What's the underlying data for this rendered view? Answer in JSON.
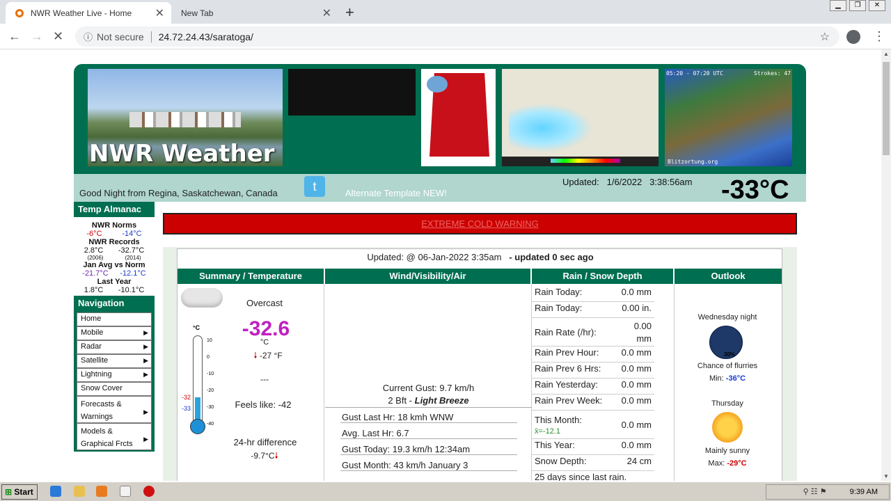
{
  "browser": {
    "tabs": [
      {
        "label": "NWR Weather Live - Home",
        "close": "✕"
      },
      {
        "label": "New Tab",
        "close": "✕"
      }
    ],
    "new_tab": "+",
    "security": "Not secure",
    "url": "24.72.24.43/saratoga/"
  },
  "header": {
    "site_title": "NWR Weather",
    "lightning_time": "05:20 - 07:20 UTC",
    "lightning_strokes": "Strokes: 47",
    "lightning_credit": "Blitzortung.org",
    "greeting": "Good Night from Regina, Saskatchewan, Canada",
    "alt_template": "Alternate Template NEW!",
    "updated_label": "Updated:",
    "updated_date": "1/6/2022",
    "updated_time": "3:38:56am",
    "current_temp": "-33°C"
  },
  "almanac": {
    "heading": "Temp Almanac",
    "norms_label": "NWR Norms",
    "norm_high": "-6°C",
    "norm_low": "-14°C",
    "records_label": "NWR Records",
    "record_high": "2.8°C",
    "record_low": "-32.7°C",
    "record_high_year": "(2006)",
    "record_low_year": "(2014)",
    "avg_label": "Jan Avg vs Norm",
    "avg_high": "-21.7°C",
    "avg_low": "-12.1°C",
    "last_year_label": "Last Year",
    "last_year_high": "1.8°C",
    "last_year_low": "-10.1°C"
  },
  "navigation": {
    "heading": "Navigation",
    "items": [
      "Home",
      "Mobile",
      "Radar",
      "Satellite",
      "Lightning",
      "Snow Cover",
      "Forecasts & Warnings",
      "Models & Graphical Frcts"
    ]
  },
  "warning": "EXTREME COLD WARNING",
  "panel": {
    "updated": "Updated: @ 06-Jan-2022 3:35am",
    "updated_ago": "- updated 0 sec ago",
    "headers": [
      "Summary / Temperature",
      "Wind/Visibility/Air",
      "Rain / Snow Depth",
      "Outlook"
    ]
  },
  "summary": {
    "condition": "Overcast",
    "temp": "-32.6",
    "unit": "°C",
    "temp_f": "-27 °F",
    "dashes": "---",
    "feels_like": "Feels like: -42",
    "diff_label": "24-hr difference",
    "diff_value": "-9.7°C",
    "scale_unit": "°C",
    "scale_ticks": [
      "10",
      "0",
      "-10",
      "-20",
      "-30",
      "-40"
    ],
    "hi_marker": "-32",
    "lo_marker": "-33"
  },
  "wind": {
    "current_gust": "Current Gust: 9.7 km/h",
    "bft": "2 Bft -",
    "bft_desc": "Light Breeze",
    "rows": [
      "Gust Last Hr: 18 kmh WNW",
      "Avg. Last Hr: 6.7",
      "Gust Today: 19.3 km/h 12:34am",
      "Gust Month: 43 km/h January 3"
    ]
  },
  "rain": {
    "rows": [
      {
        "label": "Rain Today:",
        "value": "0.0 mm"
      },
      {
        "label": "Rain Today:",
        "value": "0.00  in."
      },
      {
        "label": "Rain Rate (/hr):",
        "value": "0.00 mm"
      },
      {
        "label": "Rain Prev Hour:",
        "value": "0.0 mm"
      },
      {
        "label": "Rain Prev 6 Hrs:",
        "value": "0.0 mm"
      },
      {
        "label": "Rain Yesterday:",
        "value": "0.0 mm"
      },
      {
        "label": "Rain Prev Week:",
        "value": "0.0 mm"
      },
      {
        "label": "This Month:",
        "value": "0.0 mm"
      },
      {
        "label": "This Year:",
        "value": "0.0 mm"
      },
      {
        "label": "Snow Depth:",
        "value": "24 cm"
      }
    ],
    "month_note": "x̄=-12.1",
    "since_rain": "25 days since last rain."
  },
  "outlook": {
    "p1_title": "Wednesday night",
    "p1_pct": "30%",
    "p1_desc": "Chance of flurries",
    "p1_temp_label": "Min:",
    "p1_temp": "-36°C",
    "p2_title": "Thursday",
    "p2_desc": "Mainly sunny",
    "p2_temp_label": "Max:",
    "p2_temp": "-29°C"
  },
  "taskbar": {
    "start": "Start",
    "clock": "9:39 AM"
  }
}
